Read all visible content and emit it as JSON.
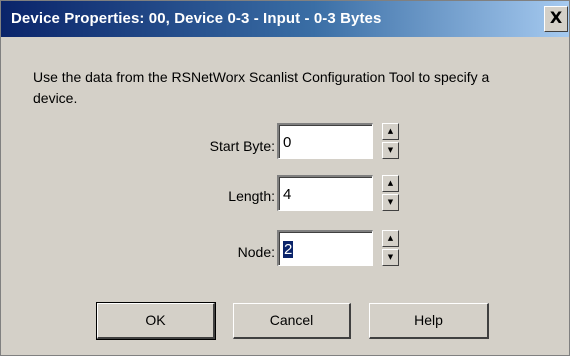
{
  "window": {
    "title": "Device Properties: 00, Device 0-3 - Input - 0-3 Bytes",
    "close_label": "X"
  },
  "description": "Use the data from the RSNetWorx Scanlist Configuration Tool to specify a device.",
  "fields": {
    "start_byte": {
      "label": "Start Byte:",
      "value": "0"
    },
    "length": {
      "label": "Length:",
      "value": "4"
    },
    "node": {
      "label": "Node:",
      "value": "2"
    }
  },
  "spinner": {
    "up_glyph": "▲",
    "down_glyph": "▼"
  },
  "buttons": {
    "ok": "OK",
    "cancel": "Cancel",
    "help": "Help"
  }
}
